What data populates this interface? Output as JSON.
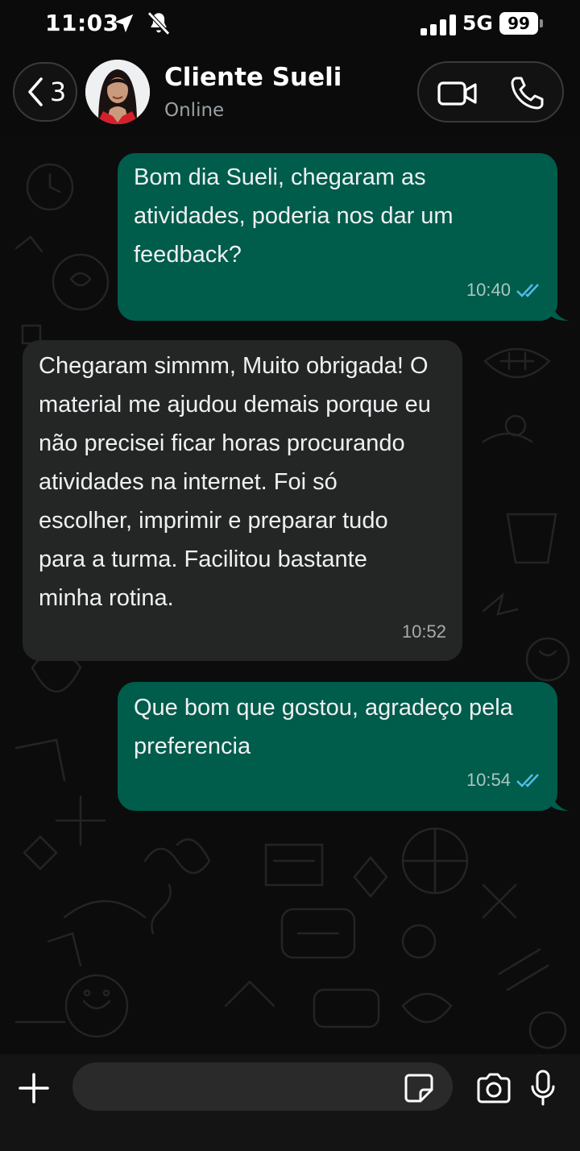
{
  "status_bar": {
    "time": "11:03",
    "network": "5G",
    "battery": "99"
  },
  "header": {
    "back_count": "3",
    "contact_name": "Cliente Sueli",
    "contact_status": "Online"
  },
  "messages": [
    {
      "direction": "outgoing",
      "lines": [
        "Bom dia Sueli, chegaram as",
        "atividades, poderia nos dar um",
        "feedback?"
      ],
      "time": "10:40",
      "read": true
    },
    {
      "direction": "incoming",
      "lines": [
        "Chegaram simmm, Muito obrigada! O",
        "material me ajudou demais porque eu",
        "não precisei ficar horas procurando",
        "atividades na internet. Foi só",
        "escolher, imprimir e preparar tudo",
        "para a turma. Facilitou bastante",
        "minha rotina."
      ],
      "time": "10:52"
    },
    {
      "direction": "outgoing",
      "lines": [
        "Que bom que gostou, agradeço pela",
        "preferencia"
      ],
      "time": "10:54",
      "read": true
    }
  ],
  "composer": {
    "value": "",
    "placeholder": ""
  },
  "colors": {
    "outgoing_bubble": "#005c4b",
    "incoming_bubble": "#242626",
    "read_ticks": "#53bdeb",
    "background": "#0b0b0b"
  },
  "icons": [
    "location-arrow-icon",
    "bell-slash-icon",
    "signal-icon",
    "chevron-left-icon",
    "video-camera-icon",
    "phone-icon",
    "plus-icon",
    "sticker-icon",
    "camera-icon",
    "microphone-icon",
    "double-check-icon"
  ]
}
